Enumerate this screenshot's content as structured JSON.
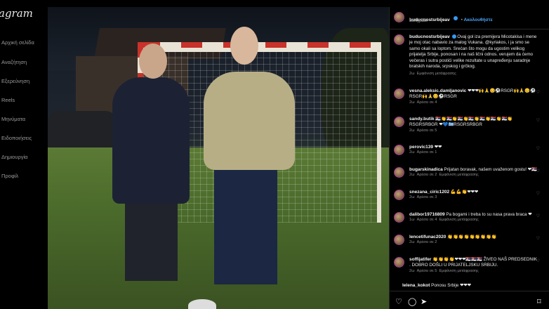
{
  "nav": {
    "logo": "agram",
    "items": [
      {
        "label": "Αρχική σελίδα",
        "icon": "home-icon"
      },
      {
        "label": "Αναζήτηση",
        "icon": "search-icon"
      },
      {
        "label": "Εξερεύνηση",
        "icon": "explore-icon"
      },
      {
        "label": "Reels",
        "icon": "reels-icon"
      },
      {
        "label": "Μηνύματα",
        "icon": "messages-icon"
      },
      {
        "label": "Ειδοποιήσεις",
        "icon": "heart-icon"
      },
      {
        "label": "Δημιουργία",
        "icon": "create-icon"
      },
      {
        "label": "Προφίλ",
        "icon": "profile-icon"
      }
    ]
  },
  "post": {
    "header": {
      "username": "buducnostsrbijeav",
      "follow": "Ακολουθήστε",
      "location": "Βελιγράδι"
    },
    "caption": {
      "username": "buducnostsrbijeav",
      "text": "Ovaj gol iza premijera Micotakisa i mene je moj otac nabavio za malog Vukana. @kyriakos, i ja smo se samo okali sa loptom. Srećan što mogu da ugostim velikog prijatelja Srbije, ponosan i na naš lični odnos. verujem da ćemo večeras i sutra postići velike rezultate u unapređenju saradnje bratskih naroda, srpskog i grčkog.",
      "time": "2ω",
      "translate": "Εμφάνιση μετάφρασης"
    },
    "comments": [
      {
        "user": "vesna.aleksic.damljanovic",
        "text": "❤❤❤🙌🙏😊⚽RSGR🙌🙏😊⚽ RSGR🙌🙏😊⚽RSGR",
        "time": "2ω",
        "likes": "Αρέσει σε 4",
        "extra": ""
      },
      {
        "user": "sandy.butik",
        "text": "🇷🇸👏🇷🇸👏🇷🇸👏🇷🇸👏🇷🇸👏🇷🇸👏🇷🇸👏RSGRSRBGR ❤💙🇬🇷RSGRSRBGR",
        "time": "2ω",
        "likes": "Αρέσει σε 5",
        "extra": ""
      },
      {
        "user": "perovic139",
        "text": "❤❤",
        "time": "2ω",
        "likes": "Αρέσει σε 1",
        "extra": ""
      },
      {
        "user": "bugarskinadica",
        "text": "Prijatan boravak, našem uvaženom gostu! ❤🇷🇸",
        "time": "2ω",
        "likes": "Αρέσει σε 2",
        "extra": "Εμφάνιση μετάφρασης"
      },
      {
        "user": "snezana_ciric1202",
        "text": "💪💪👏❤❤❤",
        "time": "2ω",
        "likes": "Αρέσει σε 3",
        "extra": ""
      },
      {
        "user": "dalibor19716809",
        "text": "Pa bogami i treba to su nasa prava braca ❤",
        "time": "1ω",
        "likes": "Αρέσει σε 4",
        "extra": "Εμφάνιση μετάφρασης"
      },
      {
        "user": "lencetifunac2020",
        "text": "👏👏👏👏👏👏👏👏👏",
        "time": "2ω",
        "likes": "Αρέσει σε 2",
        "extra": ""
      },
      {
        "user": "soffijatifer",
        "text": "👏👏👏👏❤❤❤🇷🇸🇷🇸🇷🇸 ŽIVEO NAŠ PREDSEDNIK . DOBRO DOŠLI U PRIJATELJSKU SRBIJU.",
        "time": "2ω",
        "likes": "Αρέσει σε 5",
        "extra": "Εμφάνιση μετάφρασης"
      },
      {
        "user": "lelena_kokot",
        "text": "Ponosu Srbije ❤❤❤",
        "time": "",
        "likes": "",
        "extra": ""
      }
    ]
  },
  "actions": [
    "heart-icon",
    "comment-icon",
    "share-icon",
    "bookmark-icon"
  ],
  "colors": {
    "accent": "#3897f0",
    "background": "#000000",
    "text": "#f5f5f5"
  }
}
